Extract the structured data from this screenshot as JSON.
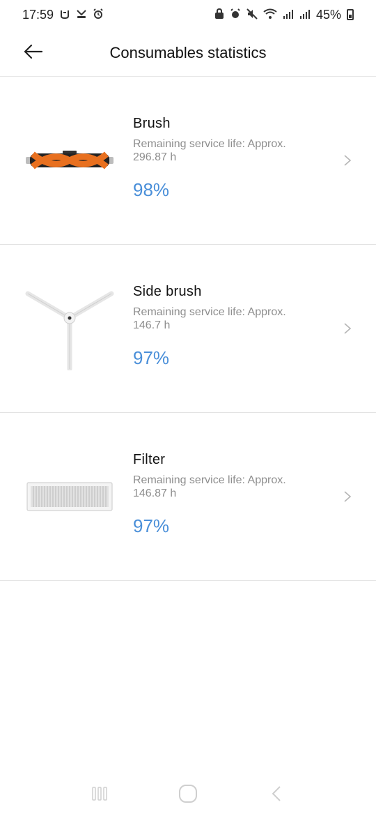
{
  "status_bar": {
    "time": "17:59",
    "battery_text": "45%"
  },
  "header": {
    "title": "Consumables statistics",
    "back_icon": "arrow-left-icon"
  },
  "consumables": [
    {
      "name": "Brush",
      "remaining_label": "Remaining service life: Approx.",
      "hours": "296.87 h",
      "percent": "98%"
    },
    {
      "name": "Side brush",
      "remaining_label": "Remaining service life: Approx.",
      "hours": "146.7 h",
      "percent": "97%"
    },
    {
      "name": "Filter",
      "remaining_label": "Remaining service life: Approx.",
      "hours": "146.87 h",
      "percent": "97%"
    }
  ],
  "colors": {
    "accent": "#4a8fd9",
    "brush_orange": "#e8701f",
    "secondary_text": "#8e8e8e",
    "divider": "#e3e3e3"
  },
  "nav_bar": {
    "recents_icon": "recents-icon",
    "home_icon": "home-icon",
    "back_icon": "back-chevron-icon"
  }
}
